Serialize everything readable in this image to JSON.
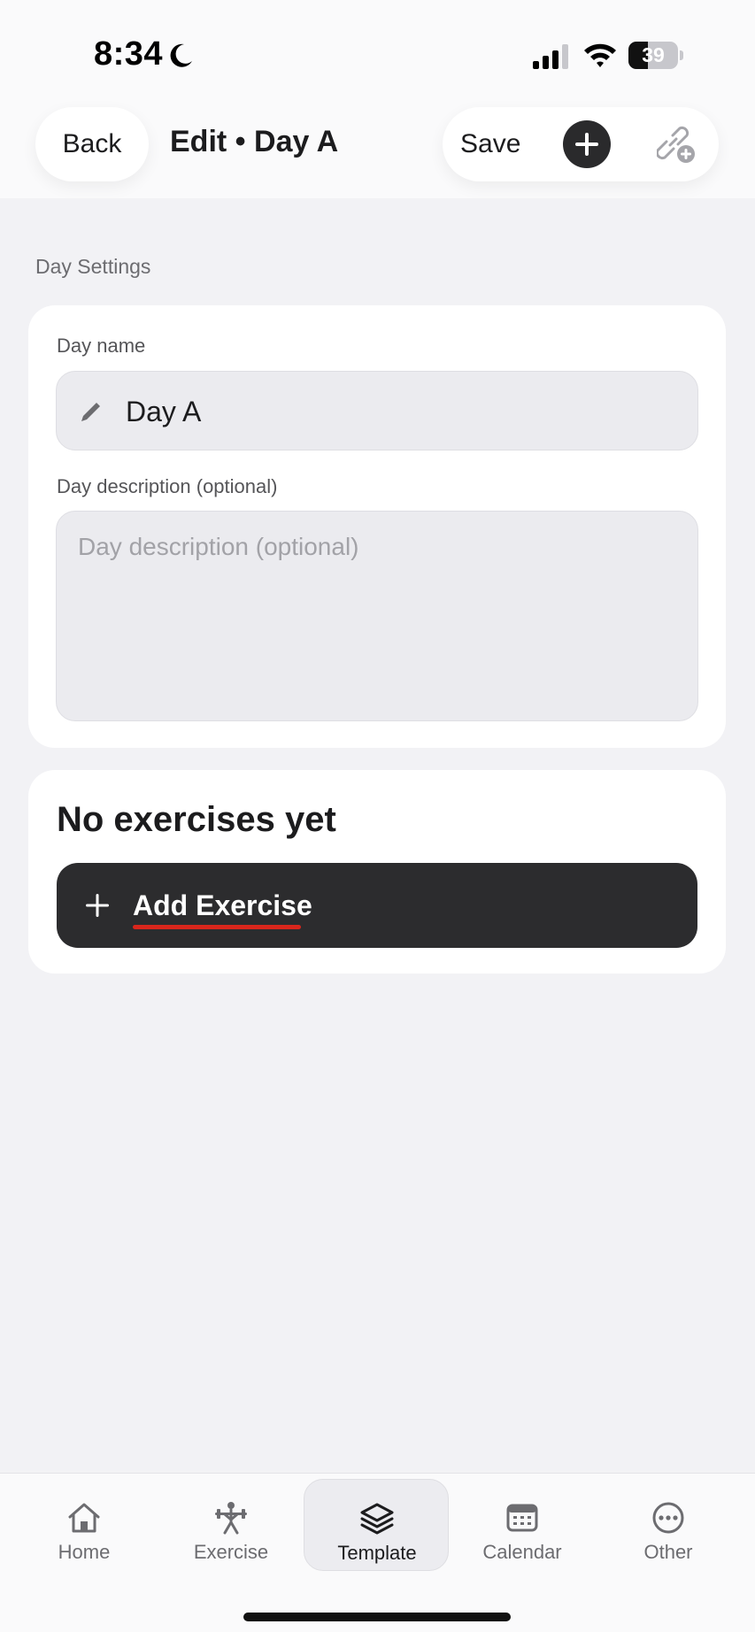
{
  "status_bar": {
    "time": "8:34",
    "battery_level": "39",
    "battery_fraction": 0.39,
    "icons": [
      "moon-icon",
      "cellular-signal-icon",
      "wifi-icon",
      "battery-icon"
    ]
  },
  "header": {
    "back_label": "Back",
    "title": "Edit • Day A",
    "save_label": "Save",
    "icons": [
      "plus-icon",
      "link-add-icon"
    ]
  },
  "day_settings": {
    "section_label": "Day Settings",
    "name_label": "Day name",
    "name_value": "Day A",
    "description_label": "Day description (optional)",
    "description_placeholder": "Day description (optional)",
    "description_value": ""
  },
  "exercises": {
    "empty_heading": "No exercises yet",
    "add_button_label": "Add Exercise"
  },
  "tab_bar": {
    "tabs": [
      {
        "label": "Home",
        "icon": "home-icon",
        "active": false
      },
      {
        "label": "Exercise",
        "icon": "weightlifter-icon",
        "active": false
      },
      {
        "label": "Template",
        "icon": "layers-icon",
        "active": true
      },
      {
        "label": "Calendar",
        "icon": "calendar-icon",
        "active": false
      },
      {
        "label": "Other",
        "icon": "more-icon",
        "active": false
      }
    ]
  },
  "colors": {
    "background": "#f2f2f5",
    "primary_dark": "#2c2c2e",
    "accent_underline": "#d9261c"
  }
}
